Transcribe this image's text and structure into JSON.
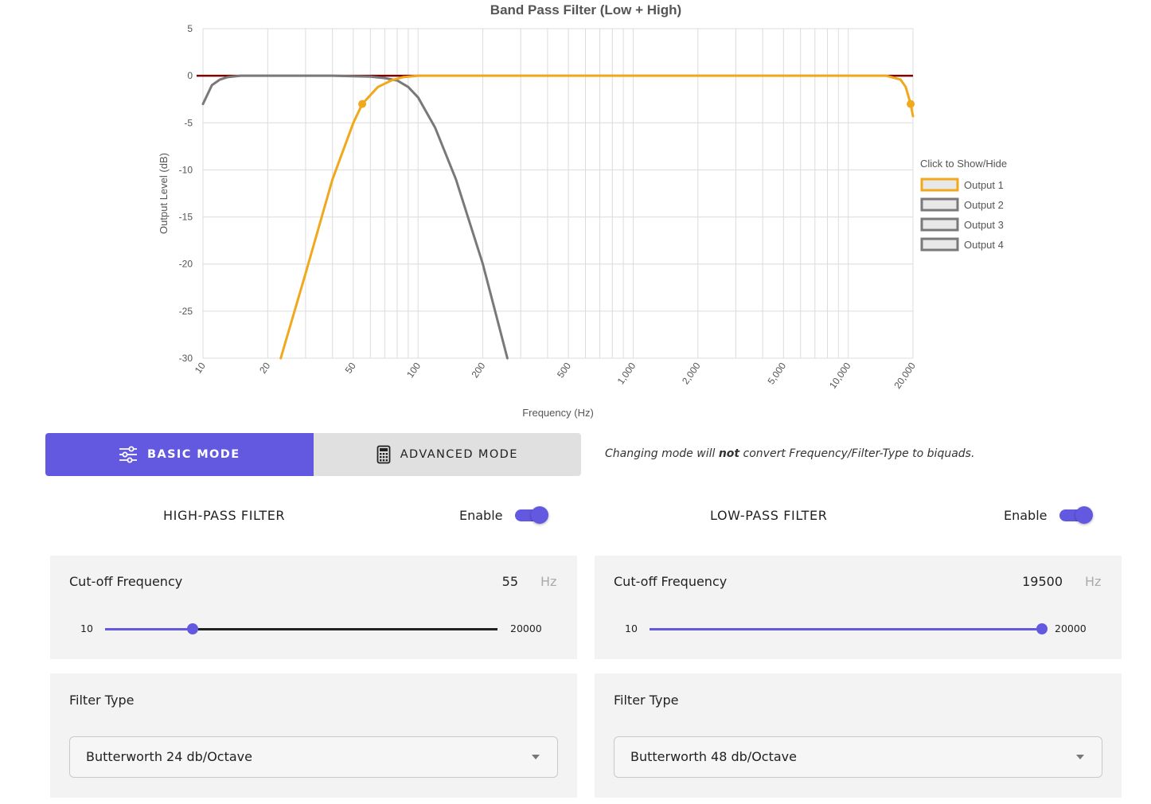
{
  "chart_data": {
    "type": "line",
    "title": "Band Pass Filter (Low + High)",
    "xlabel": "Frequency (Hz)",
    "ylabel": "Output Level (dB)",
    "x_scale": "log",
    "xlim": [
      10,
      20000
    ],
    "ylim": [
      -30,
      5
    ],
    "x_ticks": [
      10,
      20,
      50,
      100,
      200,
      500,
      1000,
      2000,
      5000,
      10000,
      20000
    ],
    "x_tick_labels": [
      "10",
      "20",
      "50",
      "100",
      "200",
      "500",
      "1,000",
      "2,000",
      "5,000",
      "10,000",
      "20,000"
    ],
    "y_ticks": [
      5,
      0,
      -5,
      -10,
      -15,
      -20,
      -25,
      -30
    ],
    "grid": true,
    "legend_title": "Click to Show/Hide",
    "legend_position": "right",
    "series": [
      {
        "name": "Output 1",
        "color": "#f0a81c",
        "x": [
          23,
          30,
          40,
          50,
          55,
          65,
          75,
          85,
          100,
          150,
          1000,
          15000,
          17500,
          18500,
          19500,
          20000
        ],
        "y": [
          -30,
          -21,
          -11,
          -5,
          -3,
          -1.2,
          -0.5,
          -0.15,
          0,
          0,
          0,
          0,
          -0.4,
          -1.2,
          -3,
          -4.3
        ]
      },
      {
        "name": "Output 2",
        "color": "#7a7878",
        "x": [
          10,
          11,
          12,
          13,
          15,
          20,
          40,
          60,
          70,
          80,
          90,
          100,
          120,
          150,
          200,
          260
        ],
        "y": [
          -3,
          -1,
          -0.4,
          -0.15,
          0,
          0,
          0,
          -0.1,
          -0.25,
          -0.5,
          -1.2,
          -2.3,
          -5.5,
          -11,
          -20,
          -30
        ]
      },
      {
        "name": "Output 3",
        "color": "#7a7878",
        "x": [],
        "y": []
      },
      {
        "name": "Output 4",
        "color": "#7a7878",
        "x": [],
        "y": []
      }
    ],
    "markers": [
      {
        "series": "Output 1",
        "x": 55,
        "y": -3
      },
      {
        "series": "Output 1",
        "x": 19500,
        "y": -3
      }
    ]
  },
  "mode": {
    "basic_label": "BASIC MODE",
    "advanced_label": "ADVANCED MODE",
    "note_before": "Changing mode will ",
    "note_bold": "not",
    "note_after": " convert Frequency/Filter-Type to biquads."
  },
  "high_pass": {
    "title": "HIGH-PASS FILTER",
    "enable_label": "Enable",
    "enabled": true,
    "cutoff_label": "Cut-off Frequency",
    "value": "55",
    "unit": "Hz",
    "min": "10",
    "max": "20000",
    "slider_fraction": 0.224,
    "filter_type_label": "Filter Type",
    "filter_type": "Butterworth 24 db/Octave"
  },
  "low_pass": {
    "title": "LOW-PASS FILTER",
    "enable_label": "Enable",
    "enabled": true,
    "cutoff_label": "Cut-off Frequency",
    "value": "19500",
    "unit": "Hz",
    "min": "10",
    "max": "20000",
    "slider_fraction": 1.0,
    "filter_type_label": "Filter Type",
    "filter_type": "Butterworth 48 db/Octave"
  },
  "colors": {
    "accent": "#6259e0",
    "output1": "#f0a81c",
    "output_gray": "#7a7878",
    "zero_line": "#7a0000"
  },
  "icons": {
    "basic": "sliders-icon",
    "advanced": "calculator-icon",
    "dropdown": "caret-down-icon"
  }
}
